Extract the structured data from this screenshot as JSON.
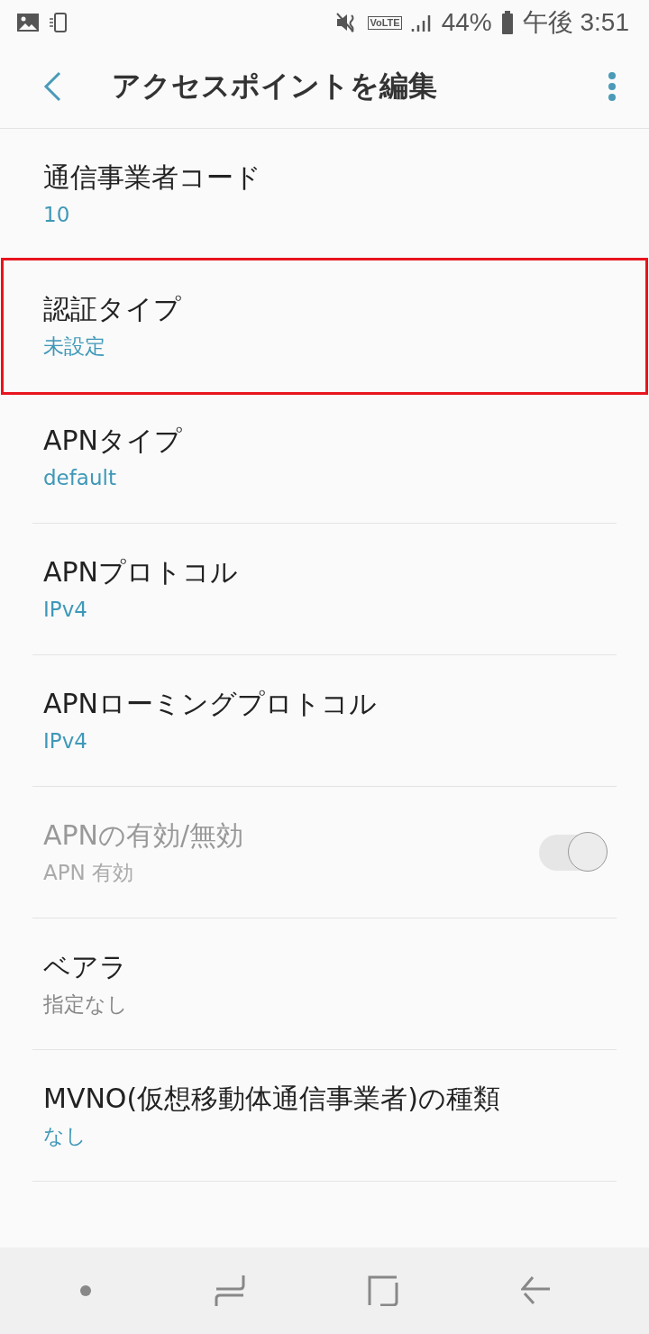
{
  "status_bar": {
    "battery": "44%",
    "time": "午後 3:51",
    "volte": "VoLTE"
  },
  "header": {
    "title": "アクセスポイントを編集"
  },
  "items": [
    {
      "kind": "text",
      "title": "通信事業者コード",
      "value": "10",
      "value_accent": true,
      "disabled": false,
      "highlighted": false,
      "divider": false
    },
    {
      "kind": "text",
      "title": "認証タイプ",
      "value": "未設定",
      "value_accent": true,
      "disabled": false,
      "highlighted": true,
      "divider": false
    },
    {
      "kind": "text",
      "title": "APNタイプ",
      "value": "default",
      "value_accent": true,
      "disabled": false,
      "highlighted": false,
      "divider": true
    },
    {
      "kind": "text",
      "title": "APNプロトコル",
      "value": "IPv4",
      "value_accent": true,
      "disabled": false,
      "highlighted": false,
      "divider": true
    },
    {
      "kind": "text",
      "title": "APNローミングプロトコル",
      "value": "IPv4",
      "value_accent": true,
      "disabled": false,
      "highlighted": false,
      "divider": true
    },
    {
      "kind": "toggle",
      "title": "APNの有効/無効",
      "value": "APN 有効",
      "value_accent": false,
      "disabled": true,
      "on": true,
      "highlighted": false,
      "divider": true
    },
    {
      "kind": "text",
      "title": "ベアラ",
      "value": "指定なし",
      "value_accent": false,
      "disabled": false,
      "highlighted": false,
      "divider": true
    },
    {
      "kind": "text",
      "title": "MVNO(仮想移動体通信事業者)の種類",
      "value": "なし",
      "value_accent": true,
      "disabled": false,
      "highlighted": false,
      "divider": true
    }
  ]
}
